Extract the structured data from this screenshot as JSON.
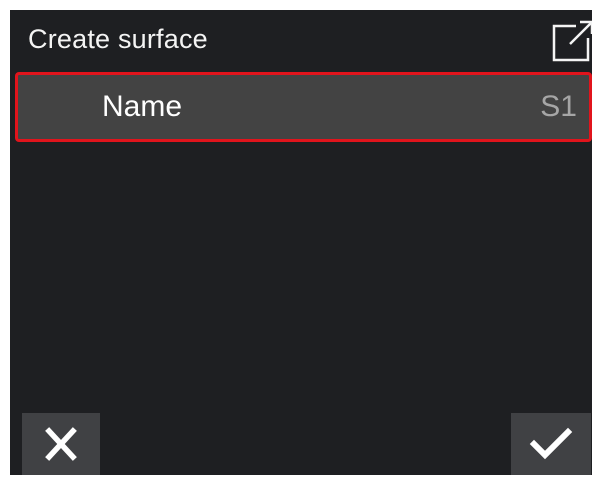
{
  "header": {
    "title": "Create surface",
    "expand_icon": "external-link-icon"
  },
  "fields": [
    {
      "label": "Name",
      "value": "S1",
      "selected": true
    }
  ],
  "footer": {
    "cancel_icon": "close-icon",
    "confirm_icon": "checkmark-icon"
  },
  "colors": {
    "background": "#1e1f22",
    "row_background": "#434343",
    "selection_border": "#e1141c",
    "button_background": "#404144",
    "text": "#ffffff",
    "value_text": "#a6a6a6"
  }
}
